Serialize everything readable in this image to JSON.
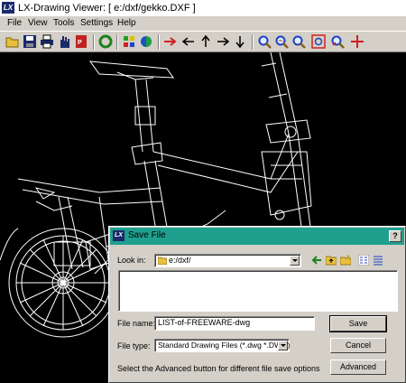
{
  "window": {
    "title": "LX-Drawing Viewer: [ e:/dxf/gekko.DXF ]",
    "app_icon_text": "LX"
  },
  "menu": [
    "File",
    "View",
    "Tools",
    "Settings",
    "Help"
  ],
  "toolbar_icons": [
    "open-icon",
    "save-icon",
    "print-icon",
    "hand-icon",
    "pdf-export-icon",
    "refresh-icon",
    "layers-icon",
    "color-icon",
    "arrow-right-icon",
    "arrow-left-icon",
    "arrow-up-icon",
    "arrow-right-2-icon",
    "arrow-down-icon",
    "zoom-in-icon",
    "zoom-out-icon",
    "zoom-window-icon",
    "zoom-extents-icon",
    "zoom-previous-icon",
    "crosshair-icon"
  ],
  "dialog": {
    "title": "Save File",
    "help": "?",
    "look_in_label": "Look in:",
    "look_in_value": "e:/dxf/",
    "file_name_label": "File name:",
    "file_name_value": "LIST-of-FREEWARE-dwg",
    "file_type_label": "File type:",
    "file_type_value": "Standard Drawing Files (*.dwg *.DWG)",
    "hint": "Select the Advanced button for different file save options",
    "save_button": "Save",
    "cancel_button": "Cancel",
    "advanced_button": "Advanced"
  },
  "colors": {
    "dialog_title_bar": "#1fa08f",
    "canvas_bg": "#000000",
    "chrome": "#d4d0c8"
  }
}
